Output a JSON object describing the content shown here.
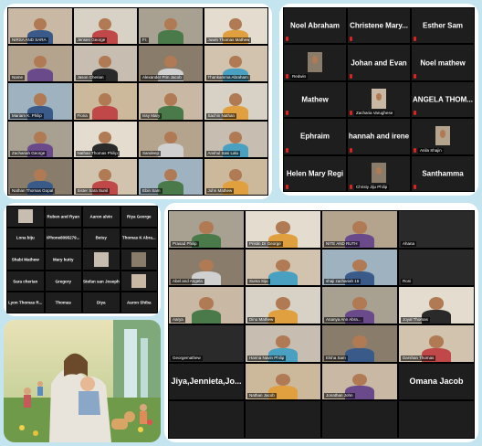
{
  "panel1": {
    "tiles": [
      "NIRSA AND SARA",
      "Jensen George",
      "Fr. ",
      "Juwin Thomas Mathew",
      "Name",
      "Jason Cherian",
      "Alexander Prin Jacob",
      "Thankamma Abraham",
      "Mariam K. Philip",
      "Fiona",
      "Issy Mary",
      "Sachin Nathan",
      "Zachariah George",
      "Nathan Thomas Philip",
      "Sandeep",
      "Anshul Sasi Lalu",
      "Nathan Thomas Gopal",
      "Sister Sara Sunil",
      "Ebin Sam",
      "John Mathew"
    ]
  },
  "panel2": {
    "tiles": [
      {
        "label": "Noel Abraham",
        "sub": ""
      },
      {
        "label": "Christene  Mary...",
        "sub": ""
      },
      {
        "label": "Esther Sam",
        "sub": ""
      },
      {
        "label": "",
        "sub": "Redwin"
      },
      {
        "label": "Johan and Evan",
        "sub": ""
      },
      {
        "label": "Noel mathew",
        "sub": ""
      },
      {
        "label": "Mathew",
        "sub": ""
      },
      {
        "label": "",
        "sub": "Zacharia Varughese"
      },
      {
        "label": "ANGELA  THOM...",
        "sub": ""
      },
      {
        "label": "Ephraim",
        "sub": ""
      },
      {
        "label": "hannah and irene",
        "sub": ""
      },
      {
        "label": "",
        "sub": "Anila Shajin"
      },
      {
        "label": "Helen Mary Regi",
        "sub": ""
      },
      {
        "label": "",
        "sub": "Christy Jiju Philip"
      },
      {
        "label": "Santhamma",
        "sub": ""
      }
    ]
  },
  "panel3": {
    "tiles": [
      "",
      "Ruben and Ryan",
      "Aaron alvin",
      "Riya George",
      "Lona biju",
      "iPhone8095279...",
      "Betsy",
      "Thomas K Abra...",
      "Shabi Mathew",
      "Mary kutty",
      "",
      "",
      "Sara cherian",
      "Gregory",
      "Stefan san Joseph",
      "",
      "Lyon Thomas R...",
      "Thomas",
      "Diya",
      "Aaron Shiba"
    ]
  },
  "panel5": {
    "tiles": [
      "Prasad Philip",
      "Pristin Dr George",
      "NITE AND RUTH",
      "Ahana",
      "Abel and Angela",
      "Suma Siju",
      "shaji zachariah 16",
      "Roni",
      "Aarya",
      "Dinu Mathew",
      "Ananya Ann Abra...",
      "Joyal Thomas",
      "Georgemathew",
      "Hanna Navin Philip",
      "Elsha Sam",
      "Darshan Thomas",
      "",
      "Nathan Jacob",
      "Jonathan John",
      ""
    ],
    "big_names": [
      "Jiya,Jennieta,Jo...",
      "Omana Jacob"
    ]
  },
  "colors": {
    "background": "#c4e4f0",
    "tile_dark": "#1e1e1e",
    "mic_red": "#e02020"
  }
}
